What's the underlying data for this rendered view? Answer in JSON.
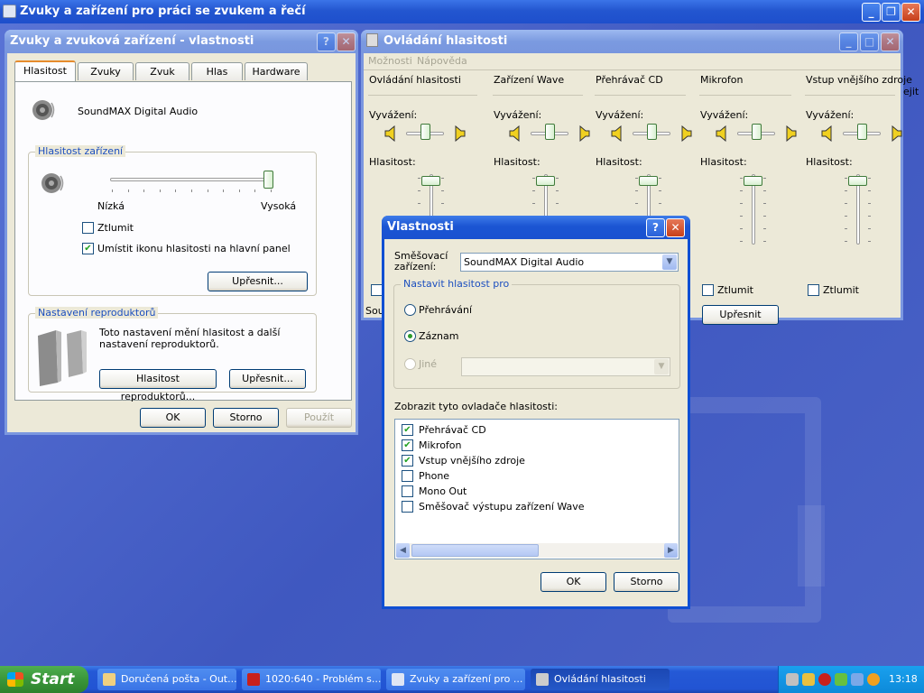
{
  "main_window": {
    "title": "Zvuky a zařízení pro práci se zvukem a řečí"
  },
  "props_window": {
    "title": "Zvuky a zvuková zařízení - vlastnosti",
    "tabs": [
      "Hlasitost",
      "Zvuky",
      "Zvuk",
      "Hlas",
      "Hardware"
    ],
    "device_name": "SoundMAX Digital Audio",
    "device_volume_title": "Hlasitost zařízení",
    "low_label": "Nízká",
    "high_label": "Vysoká",
    "volume_level": 1.0,
    "mute_label": "Ztlumit",
    "mute_checked": false,
    "tray_icon_label": "Umístit ikonu hlasitosti na hlavní panel",
    "tray_icon_checked": true,
    "advanced_label": "Upřesnit...",
    "speaker_settings_title": "Nastavení reproduktorů",
    "speaker_text": "Toto nastavení mění hlasitost a další nastavení reproduktorů.",
    "speaker_volume_button": "Hlasitost reproduktorů...",
    "speaker_advanced_button": "Upřesnit...",
    "ok": "OK",
    "cancel": "Storno",
    "apply": "Použít"
  },
  "volume_control": {
    "title": "Ovládání hlasitosti",
    "menu": [
      "Možnosti",
      "Nápověda"
    ],
    "columns": [
      {
        "name": "Ovládání hlasitosti",
        "balance_label": "Vyvážení:",
        "volume_label": "Hlasitost:"
      },
      {
        "name": "Zařízení Wave",
        "balance_label": "Vyvážení:",
        "volume_label": "Hlasitost:"
      },
      {
        "name": "Přehrávač CD",
        "balance_label": "Vyvážení:",
        "volume_label": "Hlasitost:"
      },
      {
        "name": "Mikrofon",
        "balance_label": "Vyvážení:",
        "volume_label": "Hlasitost:",
        "mute_label": "Ztlumit",
        "advanced_label": "Upřesnit"
      },
      {
        "name": "Vstup vnějšího zdroje",
        "balance_label": "Vyvážení:",
        "volume_label": "Hlasitost:",
        "mute_label": "Ztlumit"
      }
    ],
    "status_fragment": "Sou",
    "clipped_fragment": "ejit"
  },
  "dialog": {
    "title": "Vlastnosti",
    "mixer_label": "Směšovací zařízení:",
    "mixer_value": "SoundMAX Digital Audio",
    "adjust_title": "Nastavit hlasitost pro",
    "radio_playback": "Přehrávání",
    "radio_record": "Záznam",
    "radio_other": "Jiné",
    "selected_radio": "Záznam",
    "show_label": "Zobrazit tyto ovladače hlasitosti:",
    "items": [
      {
        "label": "Přehrávač CD",
        "checked": true
      },
      {
        "label": "Mikrofon",
        "checked": true
      },
      {
        "label": "Vstup vnějšího zdroje",
        "checked": true
      },
      {
        "label": "Phone",
        "checked": false
      },
      {
        "label": "Mono Out",
        "checked": false
      },
      {
        "label": "Směšovač výstupu zařízení Wave",
        "checked": false
      }
    ],
    "ok": "OK",
    "cancel": "Storno"
  },
  "taskbar": {
    "start": "Start",
    "items": [
      {
        "label": "Doručená pošta - Out...",
        "active": false
      },
      {
        "label": "1020:640 - Problém s...",
        "active": false
      },
      {
        "label": "Zvuky a zařízení pro ...",
        "active": false
      },
      {
        "label": "Ovládání hlasitosti",
        "active": true
      }
    ],
    "clock": "13:18"
  },
  "colors": {
    "xp_blue": "#0f4fd3",
    "dialog_bg": "#ece9d8",
    "start_green": "#3a963a",
    "tray_blue": "#0d8ad9"
  }
}
